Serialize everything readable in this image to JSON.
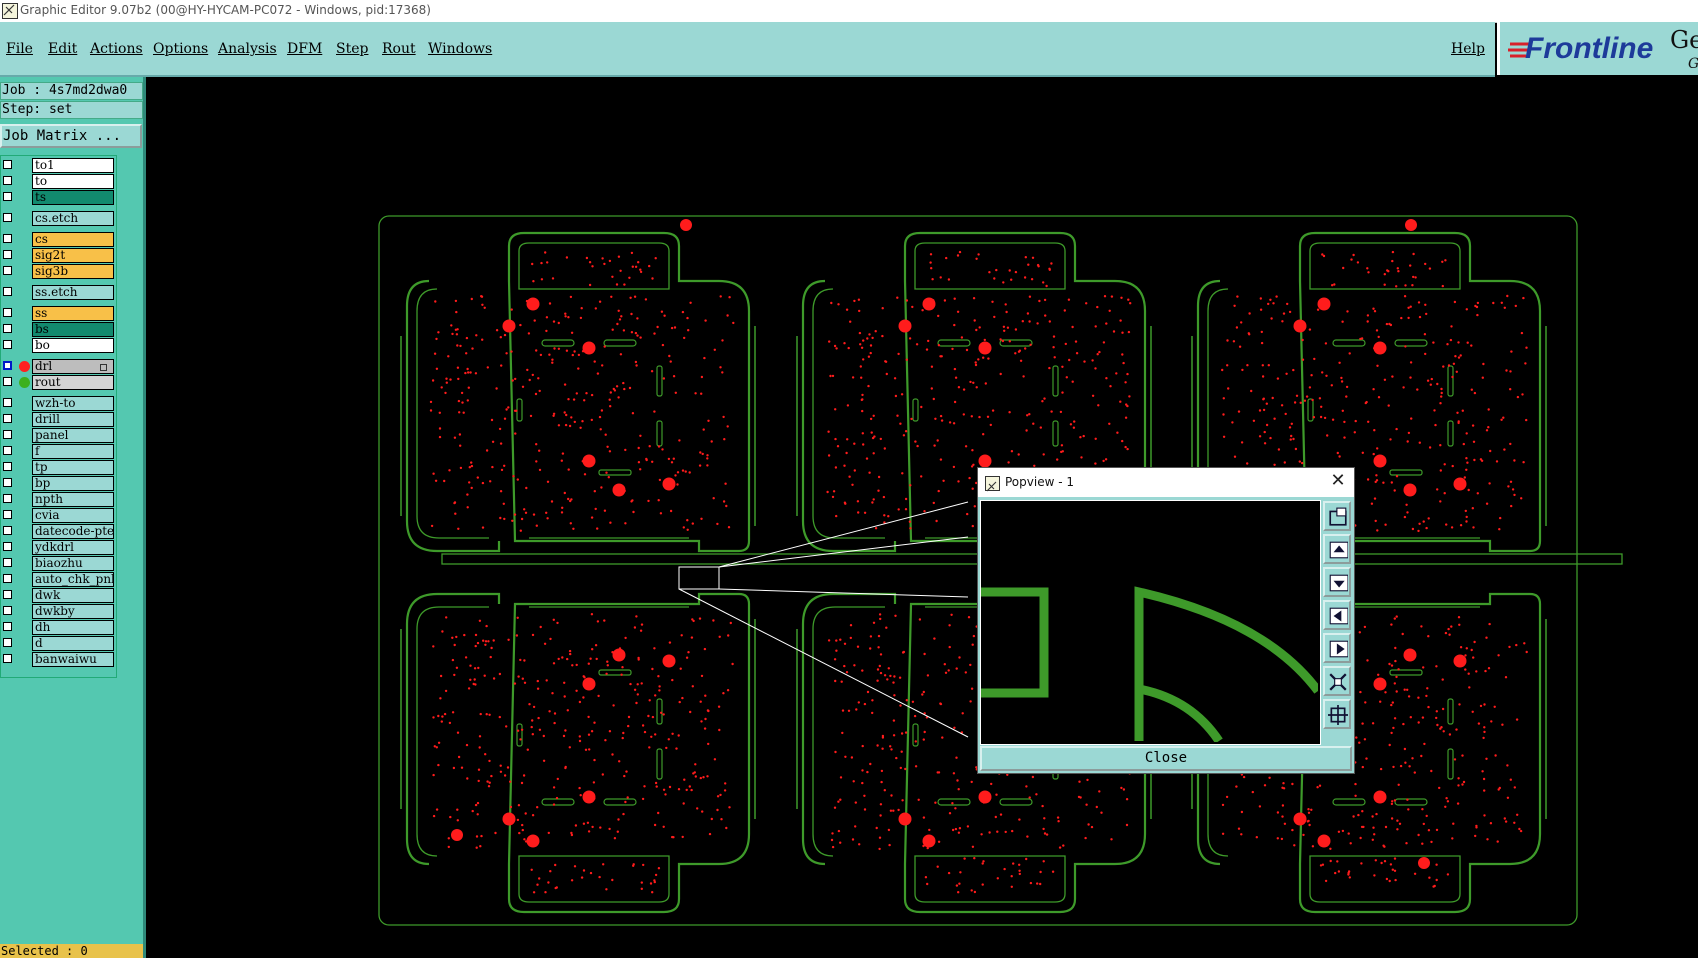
{
  "window": {
    "title": "Graphic Editor 9.07b2 (00@HY-HYCAM-PC072 - Windows, pid:17368)"
  },
  "menu": {
    "file": "File",
    "edit": "Edit",
    "actions": "Actions",
    "options": "Options",
    "analysis": "Analysis",
    "dfm": "DFM",
    "step": "Step",
    "rout": "Rout",
    "windows": "Windows",
    "help": "Help"
  },
  "logo": {
    "brand": "Frontline",
    "suffix": "Ge",
    "suffix2": "G"
  },
  "job": {
    "job_line": "Job : 4s7md2dwa0",
    "step_line": "Step: set",
    "matrix_button": "Job Matrix ..."
  },
  "layers": [
    {
      "name": "to1",
      "bg": "#ffffff"
    },
    {
      "name": "to",
      "bg": "#ffffff"
    },
    {
      "name": "ts",
      "bg": "#128a6e"
    },
    {
      "name": "cs.etch",
      "bg": "#9bd8d4"
    },
    {
      "name": "cs",
      "bg": "#f8c048"
    },
    {
      "name": "sig2t",
      "bg": "#f8c048"
    },
    {
      "name": "sig3b",
      "bg": "#f8c048"
    },
    {
      "name": "ss.etch",
      "bg": "#9bd8d4"
    },
    {
      "name": "ss",
      "bg": "#f8c048"
    },
    {
      "name": "bs",
      "bg": "#128a6e"
    },
    {
      "name": "bo",
      "bg": "#ffffff"
    },
    {
      "name": "drl",
      "bg": "#bdbdbd",
      "dot": "#ff2020",
      "active": true
    },
    {
      "name": "rout",
      "bg": "#d4d4d4",
      "dot": "#3cb01e"
    },
    {
      "name": "wzh-to",
      "bg": "#9bd8d4"
    },
    {
      "name": "drill",
      "bg": "#9bd8d4"
    },
    {
      "name": "panel",
      "bg": "#9bd8d4"
    },
    {
      "name": "f",
      "bg": "#9bd8d4"
    },
    {
      "name": "tp",
      "bg": "#9bd8d4"
    },
    {
      "name": "bp",
      "bg": "#9bd8d4"
    },
    {
      "name": "npth",
      "bg": "#9bd8d4"
    },
    {
      "name": "cvia",
      "bg": "#9bd8d4"
    },
    {
      "name": "datecode-pte",
      "bg": "#9bd8d4"
    },
    {
      "name": "ydkdrl",
      "bg": "#9bd8d4"
    },
    {
      "name": "biaozhu",
      "bg": "#9bd8d4"
    },
    {
      "name": "auto_chk_pnl",
      "bg": "#9bd8d4"
    },
    {
      "name": "dwk",
      "bg": "#9bd8d4"
    },
    {
      "name": "dwkby",
      "bg": "#9bd8d4"
    },
    {
      "name": "dh",
      "bg": "#9bd8d4"
    },
    {
      "name": "d",
      "bg": "#9bd8d4"
    },
    {
      "name": "banwaiwu",
      "bg": "#9bd8d4"
    }
  ],
  "status": {
    "selected": "Selected : 0"
  },
  "popview": {
    "title": "Popview - 1",
    "close_label": "Close",
    "tools": [
      "zoom-fit-icon",
      "pan-up-icon",
      "pan-down-icon",
      "pan-left-icon",
      "pan-right-icon",
      "zoom-out-icon",
      "zoom-in-icon"
    ]
  },
  "colors": {
    "outline": "#3e9a2a",
    "drill": "#ff1c1c",
    "panel_bg": "#9bd8d4",
    "left_bg": "#54c8b0"
  }
}
